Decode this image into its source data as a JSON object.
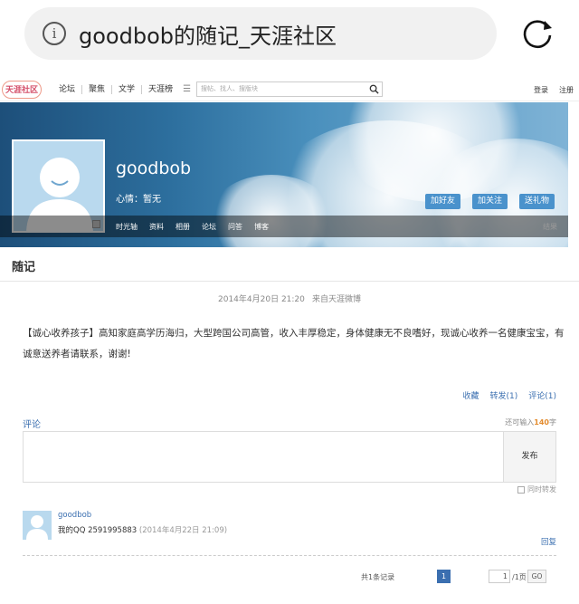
{
  "browser": {
    "title": "goodbob的随记_天涯社区"
  },
  "nav": {
    "logo": "天涯社区",
    "links": [
      "论坛",
      "聚焦",
      "文学",
      "天涯榜"
    ],
    "search_placeholder": "搜帖、找人、搜版块",
    "login": "登录",
    "register": "注册"
  },
  "profile": {
    "username": "goodbob",
    "mood": "心情：暂无",
    "add_friend": "加好友",
    "follow": "加关注",
    "gift": "送礼物",
    "tabs": [
      "时光轴",
      "资料",
      "相册",
      "论坛",
      "问答",
      "博客"
    ],
    "more": "结果"
  },
  "section": {
    "title": "随记"
  },
  "post": {
    "date": "2014年4月20日 21:20",
    "source": "来自天涯微博",
    "body": "【诚心收养孩子】高知家庭高学历海归，大型跨国公司高管，收入丰厚稳定，身体健康无不良嗜好，现诚心收养一名健康宝宝，有诚意送养者请联系，谢谢!",
    "collect": "收藏",
    "forward": "转发(1)",
    "comment": "评论(1)"
  },
  "comment_form": {
    "label": "评论",
    "remaining_prefix": "还可输入",
    "remaining_count": "140",
    "remaining_suffix": "字",
    "publish": "发布",
    "also_forward": "同时转发"
  },
  "comments": [
    {
      "user": "goodbob",
      "text": "我的QQ 2591995883",
      "time": "(2014年4月22日 21:09)",
      "reply": "回复"
    }
  ],
  "pagination": {
    "total": "共1条记录",
    "current": "1",
    "page_input": "1",
    "of_pages": "/1页",
    "go": "GO"
  }
}
